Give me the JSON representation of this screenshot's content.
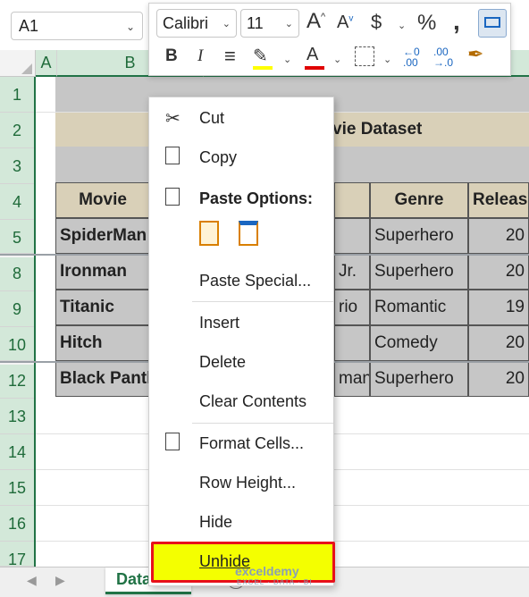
{
  "namebox": {
    "value": "A1"
  },
  "toolbar": {
    "font_name": "Calibri",
    "font_size": "11",
    "grow_font": "A",
    "shrink_font": "A",
    "currency": "$",
    "percent": "%",
    "comma": "͗",
    "bold": "B",
    "italic": "I",
    "font_color_letter": "A",
    "fill_color": "#ffff00",
    "font_color": "#e00000"
  },
  "columns": [
    "A",
    "B"
  ],
  "rows": [
    "1",
    "2",
    "3",
    "4",
    "5",
    "8",
    "9",
    "10",
    "12",
    "13",
    "14",
    "15",
    "16",
    "17"
  ],
  "sheet": {
    "title_visible": "vie Dataset",
    "headers": {
      "b": "Movie",
      "genre": "Genre",
      "release": "Releas"
    },
    "data": [
      {
        "b": "SpiderMan",
        "c": "",
        "genre": "Superhero",
        "release": "20"
      },
      {
        "b": "Ironman",
        "c": "Jr.",
        "genre": "Superhero",
        "release": "20"
      },
      {
        "b": "Titanic",
        "c": "rio",
        "genre": "Romantic",
        "release": "19"
      },
      {
        "b": "Hitch",
        "c": "",
        "genre": "Comedy",
        "release": "20"
      },
      {
        "b": "Black Panth",
        "c": "man",
        "genre": "Superhero",
        "release": "20"
      }
    ]
  },
  "context_menu": {
    "cut": "Cut",
    "copy": "Copy",
    "paste_options": "Paste Options:",
    "paste_special": "Paste Special...",
    "insert": "Insert",
    "delete": "Delete",
    "clear_contents": "Clear Contents",
    "format_cells": "Format Cells...",
    "row_height": "Row Height...",
    "hide": "Hide",
    "unhide": "Unhide"
  },
  "tabs": {
    "active_sheet": "Data"
  },
  "watermark": {
    "name": "exceldemy",
    "tagline": "EXCEL · DATA · BI"
  },
  "colors": {
    "excel_green": "#217346",
    "highlight_yellow": "#f4ff00",
    "highlight_border": "#e8101a"
  }
}
